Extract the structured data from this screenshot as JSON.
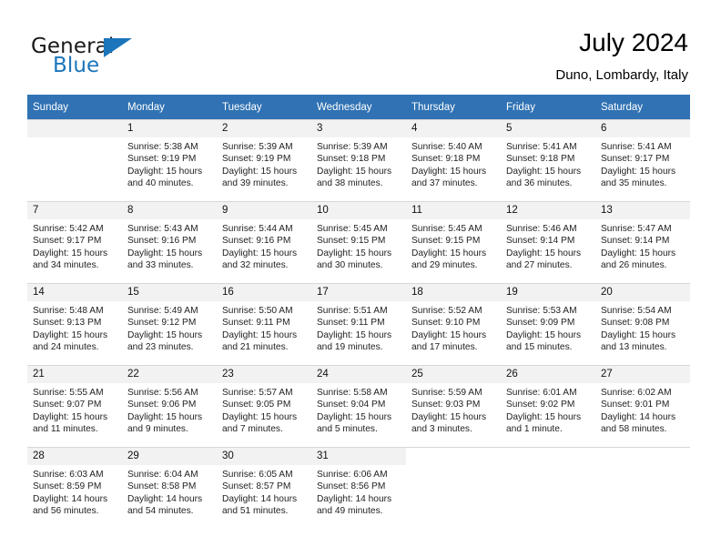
{
  "brand": {
    "name_part1": "General",
    "name_part2": "Blue",
    "accent_color": "#1b75bb"
  },
  "header": {
    "title": "July 2024",
    "subtitle": "Duno, Lombardy, Italy"
  },
  "theme": {
    "header_row_bg": "#3072b3",
    "daynum_bg": "#f2f2f2",
    "grid_line": "#d7d7d7"
  },
  "weekdays": [
    "Sunday",
    "Monday",
    "Tuesday",
    "Wednesday",
    "Thursday",
    "Friday",
    "Saturday"
  ],
  "weeks": [
    [
      {
        "day": "",
        "sunrise": "",
        "sunset": "",
        "daylight_line1": "",
        "daylight_line2": ""
      },
      {
        "day": "1",
        "sunrise": "Sunrise: 5:38 AM",
        "sunset": "Sunset: 9:19 PM",
        "daylight_line1": "Daylight: 15 hours",
        "daylight_line2": "and 40 minutes."
      },
      {
        "day": "2",
        "sunrise": "Sunrise: 5:39 AM",
        "sunset": "Sunset: 9:19 PM",
        "daylight_line1": "Daylight: 15 hours",
        "daylight_line2": "and 39 minutes."
      },
      {
        "day": "3",
        "sunrise": "Sunrise: 5:39 AM",
        "sunset": "Sunset: 9:18 PM",
        "daylight_line1": "Daylight: 15 hours",
        "daylight_line2": "and 38 minutes."
      },
      {
        "day": "4",
        "sunrise": "Sunrise: 5:40 AM",
        "sunset": "Sunset: 9:18 PM",
        "daylight_line1": "Daylight: 15 hours",
        "daylight_line2": "and 37 minutes."
      },
      {
        "day": "5",
        "sunrise": "Sunrise: 5:41 AM",
        "sunset": "Sunset: 9:18 PM",
        "daylight_line1": "Daylight: 15 hours",
        "daylight_line2": "and 36 minutes."
      },
      {
        "day": "6",
        "sunrise": "Sunrise: 5:41 AM",
        "sunset": "Sunset: 9:17 PM",
        "daylight_line1": "Daylight: 15 hours",
        "daylight_line2": "and 35 minutes."
      }
    ],
    [
      {
        "day": "7",
        "sunrise": "Sunrise: 5:42 AM",
        "sunset": "Sunset: 9:17 PM",
        "daylight_line1": "Daylight: 15 hours",
        "daylight_line2": "and 34 minutes."
      },
      {
        "day": "8",
        "sunrise": "Sunrise: 5:43 AM",
        "sunset": "Sunset: 9:16 PM",
        "daylight_line1": "Daylight: 15 hours",
        "daylight_line2": "and 33 minutes."
      },
      {
        "day": "9",
        "sunrise": "Sunrise: 5:44 AM",
        "sunset": "Sunset: 9:16 PM",
        "daylight_line1": "Daylight: 15 hours",
        "daylight_line2": "and 32 minutes."
      },
      {
        "day": "10",
        "sunrise": "Sunrise: 5:45 AM",
        "sunset": "Sunset: 9:15 PM",
        "daylight_line1": "Daylight: 15 hours",
        "daylight_line2": "and 30 minutes."
      },
      {
        "day": "11",
        "sunrise": "Sunrise: 5:45 AM",
        "sunset": "Sunset: 9:15 PM",
        "daylight_line1": "Daylight: 15 hours",
        "daylight_line2": "and 29 minutes."
      },
      {
        "day": "12",
        "sunrise": "Sunrise: 5:46 AM",
        "sunset": "Sunset: 9:14 PM",
        "daylight_line1": "Daylight: 15 hours",
        "daylight_line2": "and 27 minutes."
      },
      {
        "day": "13",
        "sunrise": "Sunrise: 5:47 AM",
        "sunset": "Sunset: 9:14 PM",
        "daylight_line1": "Daylight: 15 hours",
        "daylight_line2": "and 26 minutes."
      }
    ],
    [
      {
        "day": "14",
        "sunrise": "Sunrise: 5:48 AM",
        "sunset": "Sunset: 9:13 PM",
        "daylight_line1": "Daylight: 15 hours",
        "daylight_line2": "and 24 minutes."
      },
      {
        "day": "15",
        "sunrise": "Sunrise: 5:49 AM",
        "sunset": "Sunset: 9:12 PM",
        "daylight_line1": "Daylight: 15 hours",
        "daylight_line2": "and 23 minutes."
      },
      {
        "day": "16",
        "sunrise": "Sunrise: 5:50 AM",
        "sunset": "Sunset: 9:11 PM",
        "daylight_line1": "Daylight: 15 hours",
        "daylight_line2": "and 21 minutes."
      },
      {
        "day": "17",
        "sunrise": "Sunrise: 5:51 AM",
        "sunset": "Sunset: 9:11 PM",
        "daylight_line1": "Daylight: 15 hours",
        "daylight_line2": "and 19 minutes."
      },
      {
        "day": "18",
        "sunrise": "Sunrise: 5:52 AM",
        "sunset": "Sunset: 9:10 PM",
        "daylight_line1": "Daylight: 15 hours",
        "daylight_line2": "and 17 minutes."
      },
      {
        "day": "19",
        "sunrise": "Sunrise: 5:53 AM",
        "sunset": "Sunset: 9:09 PM",
        "daylight_line1": "Daylight: 15 hours",
        "daylight_line2": "and 15 minutes."
      },
      {
        "day": "20",
        "sunrise": "Sunrise: 5:54 AM",
        "sunset": "Sunset: 9:08 PM",
        "daylight_line1": "Daylight: 15 hours",
        "daylight_line2": "and 13 minutes."
      }
    ],
    [
      {
        "day": "21",
        "sunrise": "Sunrise: 5:55 AM",
        "sunset": "Sunset: 9:07 PM",
        "daylight_line1": "Daylight: 15 hours",
        "daylight_line2": "and 11 minutes."
      },
      {
        "day": "22",
        "sunrise": "Sunrise: 5:56 AM",
        "sunset": "Sunset: 9:06 PM",
        "daylight_line1": "Daylight: 15 hours",
        "daylight_line2": "and 9 minutes."
      },
      {
        "day": "23",
        "sunrise": "Sunrise: 5:57 AM",
        "sunset": "Sunset: 9:05 PM",
        "daylight_line1": "Daylight: 15 hours",
        "daylight_line2": "and 7 minutes."
      },
      {
        "day": "24",
        "sunrise": "Sunrise: 5:58 AM",
        "sunset": "Sunset: 9:04 PM",
        "daylight_line1": "Daylight: 15 hours",
        "daylight_line2": "and 5 minutes."
      },
      {
        "day": "25",
        "sunrise": "Sunrise: 5:59 AM",
        "sunset": "Sunset: 9:03 PM",
        "daylight_line1": "Daylight: 15 hours",
        "daylight_line2": "and 3 minutes."
      },
      {
        "day": "26",
        "sunrise": "Sunrise: 6:01 AM",
        "sunset": "Sunset: 9:02 PM",
        "daylight_line1": "Daylight: 15 hours",
        "daylight_line2": "and 1 minute."
      },
      {
        "day": "27",
        "sunrise": "Sunrise: 6:02 AM",
        "sunset": "Sunset: 9:01 PM",
        "daylight_line1": "Daylight: 14 hours",
        "daylight_line2": "and 58 minutes."
      }
    ],
    [
      {
        "day": "28",
        "sunrise": "Sunrise: 6:03 AM",
        "sunset": "Sunset: 8:59 PM",
        "daylight_line1": "Daylight: 14 hours",
        "daylight_line2": "and 56 minutes."
      },
      {
        "day": "29",
        "sunrise": "Sunrise: 6:04 AM",
        "sunset": "Sunset: 8:58 PM",
        "daylight_line1": "Daylight: 14 hours",
        "daylight_line2": "and 54 minutes."
      },
      {
        "day": "30",
        "sunrise": "Sunrise: 6:05 AM",
        "sunset": "Sunset: 8:57 PM",
        "daylight_line1": "Daylight: 14 hours",
        "daylight_line2": "and 51 minutes."
      },
      {
        "day": "31",
        "sunrise": "Sunrise: 6:06 AM",
        "sunset": "Sunset: 8:56 PM",
        "daylight_line1": "Daylight: 14 hours",
        "daylight_line2": "and 49 minutes."
      },
      {
        "day": "",
        "sunrise": "",
        "sunset": "",
        "daylight_line1": "",
        "daylight_line2": ""
      },
      {
        "day": "",
        "sunrise": "",
        "sunset": "",
        "daylight_line1": "",
        "daylight_line2": ""
      },
      {
        "day": "",
        "sunrise": "",
        "sunset": "",
        "daylight_line1": "",
        "daylight_line2": ""
      }
    ]
  ]
}
